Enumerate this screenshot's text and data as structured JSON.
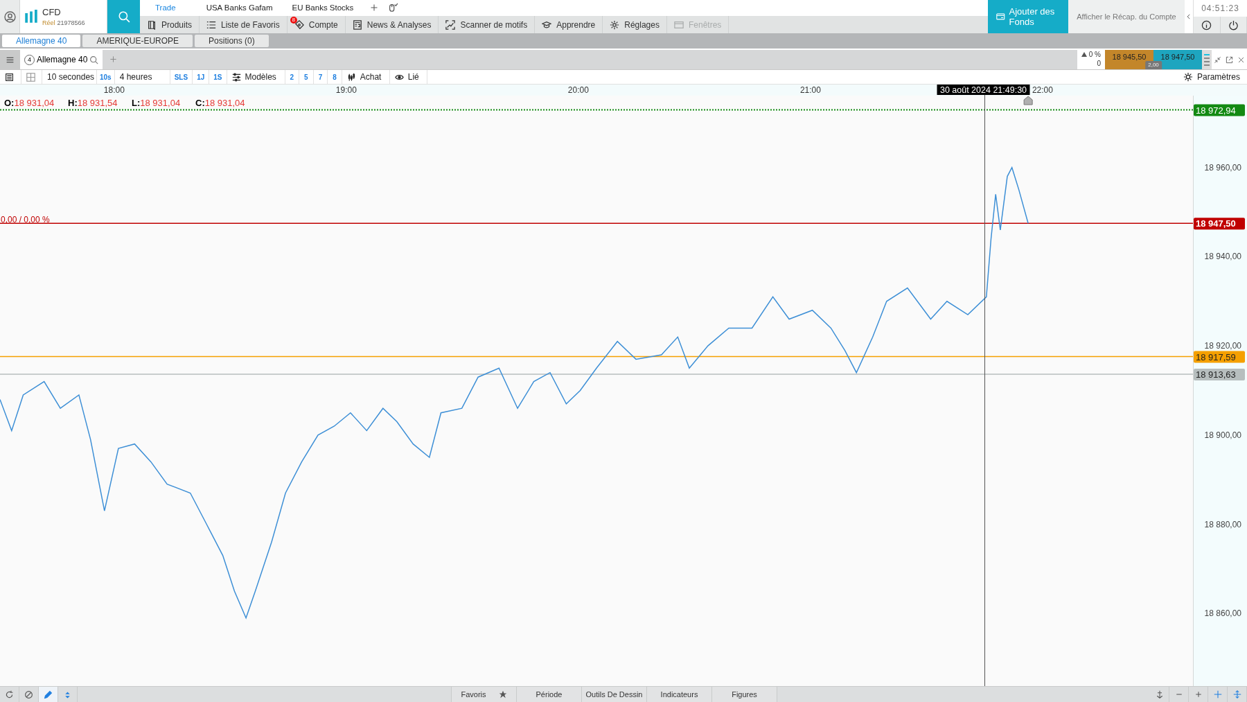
{
  "account": {
    "product": "CFD",
    "account_type": "Réel",
    "account_number": "21978566"
  },
  "top_tabs": [
    {
      "label": "Trade",
      "selected": true
    },
    {
      "label": "USA Banks Gafam",
      "selected": false
    },
    {
      "label": "EU Banks Stocks",
      "selected": false
    }
  ],
  "menu": [
    {
      "label": "Produits",
      "disabled": false
    },
    {
      "label": "Liste de Favoris",
      "disabled": false
    },
    {
      "label": "Compte",
      "disabled": false,
      "badge": "8"
    },
    {
      "label": "News & Analyses",
      "disabled": false
    },
    {
      "label": "Scanner de motifs",
      "disabled": false
    },
    {
      "label": "Apprendre",
      "disabled": false
    },
    {
      "label": "Réglages",
      "disabled": false
    },
    {
      "label": "Fenêtres",
      "disabled": true
    }
  ],
  "fund_button": "Ajouter des Fonds",
  "summary_link": "Afficher le Récap. du Compte",
  "clock": "04:51:23",
  "workspace_tabs": [
    {
      "label": "Allemagne 40",
      "selected": true
    },
    {
      "label": "AMERIQUE-EUROPE",
      "selected": false
    },
    {
      "label": "Positions (0)",
      "selected": false
    }
  ],
  "chart_tab": {
    "number": "4",
    "label": "Allemagne 40"
  },
  "quote": {
    "change": "0 %",
    "count": "0",
    "bid": "18 945,50",
    "ask": "18 947,50",
    "spread": "2,00"
  },
  "toolbar": {
    "period": "10 secondes",
    "period_short": "10s",
    "range": "4 heures",
    "quick_ranges": [
      "SLS",
      "1J",
      "1S"
    ],
    "templates": "Modèles",
    "presets": [
      "2",
      "5",
      "7",
      "8"
    ],
    "order": "Achat",
    "link": "Lié",
    "settings": "Paramètres"
  },
  "ohlc": [
    {
      "key": "O:",
      "value": "18 931,04"
    },
    {
      "key": "H:",
      "value": "18 931,54"
    },
    {
      "key": "L:",
      "value": "18 931,04"
    },
    {
      "key": "C:",
      "value": "18 931,04"
    }
  ],
  "chart": {
    "change_label": "0,00 / 0,00 %",
    "crosshair_label": "30 août 2024 21:49:30",
    "chart_data": {
      "type": "line",
      "xlim": [
        17.52,
        22.66
      ],
      "ylim": [
        18843.72,
        18976.12
      ],
      "xticks": [
        {
          "value": 18,
          "label": "18:00"
        },
        {
          "value": 19,
          "label": "19:00"
        },
        {
          "value": 20,
          "label": "20:00"
        },
        {
          "value": 21,
          "label": "21:00"
        },
        {
          "value": 22,
          "label": "22:00"
        }
      ],
      "yticks": [
        {
          "value": 18960,
          "label": "18 960,00"
        },
        {
          "value": 18940,
          "label": "18 940,00"
        },
        {
          "value": 18920,
          "label": "18 920,00"
        },
        {
          "value": 18900,
          "label": "18 900,00"
        },
        {
          "value": 18880,
          "label": "18 880,00"
        },
        {
          "value": 18860,
          "label": "18 860,00"
        }
      ],
      "x": [
        17.52,
        17.57,
        17.62,
        17.71,
        17.78,
        17.86,
        17.91,
        17.97,
        18.03,
        18.1,
        18.17,
        18.24,
        18.34,
        18.41,
        18.48,
        18.53,
        18.58,
        18.62,
        18.69,
        18.75,
        18.82,
        18.89,
        18.96,
        19.03,
        19.1,
        19.17,
        19.23,
        19.3,
        19.37,
        19.42,
        19.51,
        19.58,
        19.67,
        19.75,
        19.82,
        19.89,
        19.96,
        20.02,
        20.09,
        20.18,
        20.26,
        20.37,
        20.44,
        20.49,
        20.57,
        20.66,
        20.76,
        20.85,
        20.92,
        21.02,
        21.1,
        21.16,
        21.21,
        21.28,
        21.34,
        21.43,
        21.53,
        21.6,
        21.69,
        21.77,
        21.79,
        21.81,
        21.83,
        21.86,
        21.88,
        21.91,
        21.95
      ],
      "series": [
        {
          "color": "#3d8fd6",
          "values": [
            18908,
            18901,
            18909,
            18912,
            18906,
            18909,
            18899,
            18883,
            18897,
            18898,
            18894,
            18889,
            18887,
            18880,
            18873,
            18865,
            18859,
            18865,
            18876,
            18887,
            18894,
            18900,
            18902,
            18905,
            18901,
            18906,
            18903,
            18898,
            18895,
            18905,
            18906,
            18913,
            18915,
            18906,
            18912,
            18914,
            18907,
            18910,
            18915,
            18921,
            18917,
            18918,
            18922,
            18915,
            18920,
            18924,
            18924,
            18931,
            18926,
            18928,
            18924,
            18919,
            18914,
            18922,
            18930,
            18933,
            18926,
            18930,
            18927,
            18931,
            18944,
            18954,
            18946,
            18958,
            18960,
            18955,
            18947.5
          ]
        }
      ],
      "ref_lines": [
        {
          "axis": "y",
          "value": 18972.94,
          "label": "18 972,94",
          "color": "#138a13"
        },
        {
          "axis": "y",
          "value": 18947.5,
          "label": "18 947,50",
          "color": "#c00000"
        },
        {
          "axis": "y",
          "value": 18917.59,
          "label": "18 917,59",
          "color": "#f5a000"
        },
        {
          "axis": "y",
          "value": 18913.63,
          "label": "18 913,63",
          "color": "#b7bebe"
        }
      ]
    }
  },
  "bottom_tabs": [
    {
      "label": "Favoris",
      "star": true
    },
    {
      "label": "Période",
      "star": false
    },
    {
      "label": "Outils De Dessin",
      "star": false
    },
    {
      "label": "Indicateurs",
      "star": false
    },
    {
      "label": "Figures",
      "star": false
    }
  ],
  "bottom_tools": [
    {
      "kind": "refresh",
      "selected": false
    },
    {
      "kind": "block",
      "selected": false
    },
    {
      "kind": "pencil",
      "selected": true
    },
    {
      "kind": "arrows",
      "selected": false
    }
  ]
}
